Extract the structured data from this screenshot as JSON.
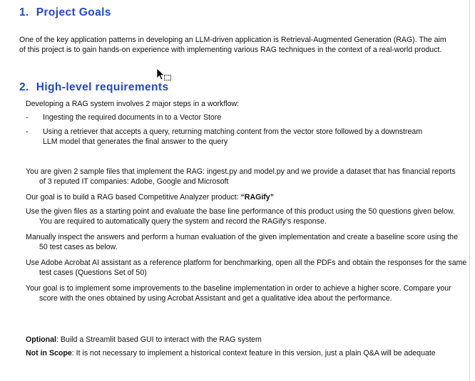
{
  "section1": {
    "number": "1.",
    "title": "Project Goals",
    "paragraph": "One of the key application patterns in developing an LLM-driven application is Retrieval-Augmented Generation (RAG). The aim of this project is to gain hands-on experience with implementing various RAG techniques in the context of a real-world product."
  },
  "section2": {
    "number": "2.",
    "title": "High-level requirements",
    "intro": "Developing a RAG system involves 2 major steps in a workflow:",
    "bullets": [
      "Ingesting the required documents in to a Vector Store",
      "Using a retriever that accepts a query, returning matching content from the vector store followed by a downstream LLM model that generates the final answer to the query"
    ],
    "bullet_marker": "-",
    "given": "You are given 2 sample files that implement the RAG: ingest.py and model.py and we provide a dataset that has financial reports of 3 reputed IT companies: Adobe, Google and Microsoft",
    "goal_text": "Our goal is to build a RAG based Competitive Analyzer product: ",
    "goal_product": "“RAGify”",
    "use_given": "Use the given files as a starting point and evaluate the base line performance of this product using the 50 questions given below. You are required to automatically query the system and record the RAGify’s response.",
    "manual": "Manually inspect the answers and perform a human evaluation of the given implementation and create a baseline score using the 50 test cases as below.",
    "acrobat": "Use Adobe Acrobat AI assistant as a reference platform for benchmarking, open all the PDFs and obtain the responses for the same test cases (Questions Set of 50)",
    "improve": "Your goal is to implement some improvements to the baseline implementation in order to achieve a higher score. Compare your score with the ones obtained by using Acrobat Assistant and get a qualitative idea about the performance.",
    "optional_label": "Optional",
    "optional_text": ": Build a Streamlit based GUI to interact with the RAG system",
    "not_in_scope_label": "Not in Scope",
    "not_in_scope_text": ": It is not necessary to implement a historical context feature in this version, just a plain Q&A will be adequate"
  },
  "icons": {
    "cursor": "move-cursor-icon"
  }
}
